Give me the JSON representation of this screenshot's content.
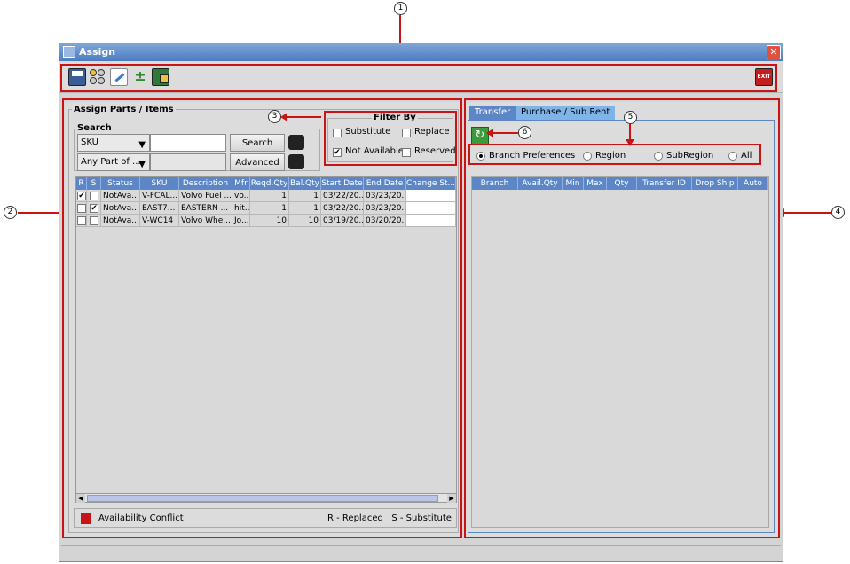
{
  "window": {
    "title": "Assign"
  },
  "callouts": {
    "c1": "1",
    "c2": "2",
    "c3": "3",
    "c4": "4",
    "c5": "5",
    "c6": "6"
  },
  "toolbar": {
    "icons": [
      "save-icon",
      "users-icon",
      "edit-icon",
      "add-icon",
      "assign-icon"
    ],
    "exit_label": "EXIT"
  },
  "left": {
    "group_title": "Assign Parts / Items",
    "search": {
      "title": "Search",
      "field_combo": "SKU",
      "match_combo": "Any Part of ...",
      "search_value": "",
      "search_button": "Search",
      "advanced_button": "Advanced"
    },
    "filter": {
      "title": "Filter By",
      "substitute": "Substitute",
      "replace": "Replace",
      "not_available": "Not Available",
      "reserved": "Reserved",
      "substitute_checked": false,
      "replace_checked": false,
      "not_available_checked": true,
      "reserved_checked": false
    },
    "table": {
      "columns": [
        "R",
        "S",
        "Status",
        "SKU",
        "Description",
        "Mfr",
        "Reqd.Qty",
        "Bal.Qty",
        "Start Date",
        "End Date",
        "Change St..."
      ],
      "rows": [
        {
          "r": "✔",
          "s": "",
          "status": "NotAva...",
          "sku": "V-FCAL...",
          "desc": "Volvo Fuel ...",
          "mfr": "vo...",
          "reqd": "1",
          "bal": "1",
          "start": "03/22/20...",
          "end": "03/23/20...",
          "change": ""
        },
        {
          "r": "",
          "s": "✔",
          "status": "NotAva...",
          "sku": "EAST7...",
          "desc": "EASTERN ...",
          "mfr": "hit...",
          "reqd": "1",
          "bal": "1",
          "start": "03/22/20...",
          "end": "03/23/20...",
          "change": ""
        },
        {
          "r": "",
          "s": "",
          "status": "NotAva...",
          "sku": "V-WC14",
          "desc": "Volvo Whe...",
          "mfr": "Jo...",
          "reqd": "10",
          "bal": "10",
          "start": "03/19/20...",
          "end": "03/20/20...",
          "change": ""
        }
      ]
    },
    "legend": {
      "conflict": "Availability Conflict",
      "replaced_substitute": "R - Replaced   S - Substitute",
      "conflict_color": "#c81414"
    }
  },
  "right": {
    "tabs": [
      "Transfer",
      "Purchase / Sub Rent"
    ],
    "radios": [
      "Branch Preferences",
      "Region",
      "SubRegion",
      "All"
    ],
    "selected_radio": "Branch Preferences",
    "columns": [
      "Branch",
      "Avail.Qty",
      "Min",
      "Max",
      "Qty",
      "Transfer ID",
      "Drop Ship",
      "Auto"
    ]
  },
  "colors": {
    "annotation": "#c81414",
    "table_header": "#5d86c7",
    "tab_active": "#5d86c7",
    "tab_inactive": "#7eb4e8"
  }
}
